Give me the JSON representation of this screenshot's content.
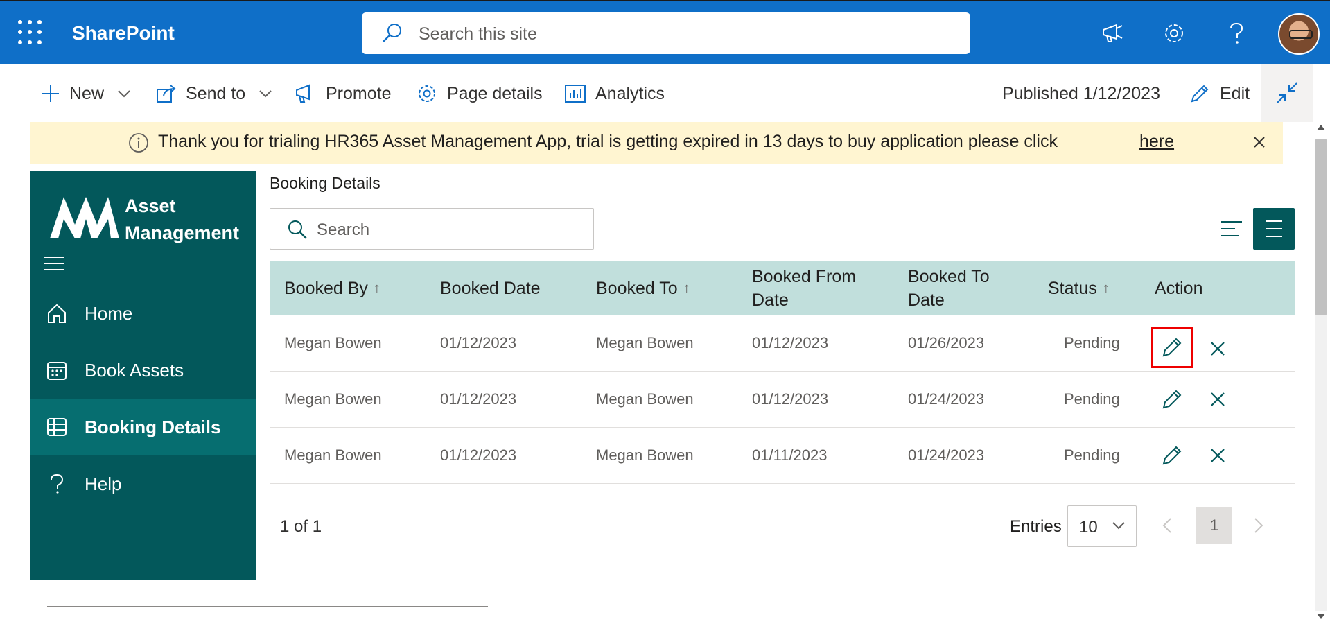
{
  "suite": {
    "brand": "SharePoint",
    "search_placeholder": "Search this site"
  },
  "commandbar": {
    "new_label": "New",
    "send_to_label": "Send to",
    "promote_label": "Promote",
    "page_details_label": "Page details",
    "analytics_label": "Analytics",
    "published_label": "Published 1/12/2023",
    "edit_label": "Edit"
  },
  "banner": {
    "message": "Thank you for trialing HR365 Asset Management App, trial is getting expired in 13 days to buy application please click",
    "link_label": "here"
  },
  "app": {
    "logo_line1": "Asset",
    "logo_line2": "Management",
    "nav": [
      {
        "label": "Home",
        "icon": "home-icon"
      },
      {
        "label": "Book Assets",
        "icon": "calendar-icon"
      },
      {
        "label": "Booking Details",
        "icon": "table-icon",
        "active": true
      },
      {
        "label": "Help",
        "icon": "help-icon"
      }
    ]
  },
  "main": {
    "title": "Booking Details",
    "search_placeholder": "Search",
    "columns": [
      {
        "label": "Booked By",
        "sort": "↑"
      },
      {
        "label": "Booked Date",
        "sort": ""
      },
      {
        "label": "Booked To",
        "sort": "↑"
      },
      {
        "label": "Booked From Date",
        "sort": ""
      },
      {
        "label": "Booked To Date",
        "sort": ""
      },
      {
        "label": "Status",
        "sort": "↑"
      },
      {
        "label": "Action",
        "sort": ""
      }
    ],
    "rows": [
      {
        "booked_by": "Megan Bowen",
        "booked_date": "01/12/2023",
        "booked_to": "Megan Bowen",
        "from": "01/12/2023",
        "to": "01/26/2023",
        "status": "Pending"
      },
      {
        "booked_by": "Megan Bowen",
        "booked_date": "01/12/2023",
        "booked_to": "Megan Bowen",
        "from": "01/12/2023",
        "to": "01/24/2023",
        "status": "Pending"
      },
      {
        "booked_by": "Megan Bowen",
        "booked_date": "01/12/2023",
        "booked_to": "Megan Bowen",
        "from": "01/11/2023",
        "to": "01/24/2023",
        "status": "Pending"
      }
    ],
    "pager": {
      "count": "1 of 1",
      "entries_label": "Entries",
      "entries_value": "10",
      "current_page": "1"
    }
  },
  "colors": {
    "suite_blue": "#0f6fc8",
    "app_teal": "#03585b",
    "active_teal": "#066e70",
    "header_row": "#c1dfdc",
    "banner_bg": "#fff5d1",
    "highlight": "#ee0000"
  }
}
